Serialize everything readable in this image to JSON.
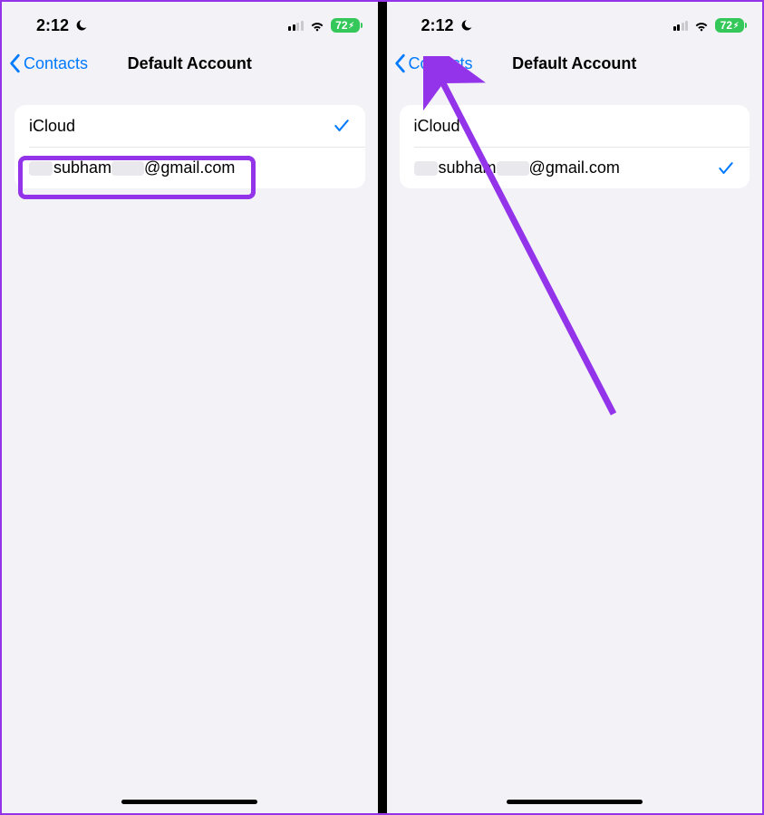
{
  "status": {
    "time": "2:12",
    "battery_percent": "72"
  },
  "nav": {
    "back_label": "Contacts",
    "title": "Default Account"
  },
  "left_screen": {
    "accounts": [
      {
        "label": "iCloud",
        "selected": true
      },
      {
        "label_prefix": "subham",
        "label_suffix": "@gmail.com",
        "selected": false
      }
    ]
  },
  "right_screen": {
    "accounts": [
      {
        "label": "iCloud",
        "selected": false
      },
      {
        "label_prefix": "subham",
        "label_suffix": "@gmail.com",
        "selected": true
      }
    ]
  },
  "annotations": {
    "highlight_color": "#9333ea"
  }
}
